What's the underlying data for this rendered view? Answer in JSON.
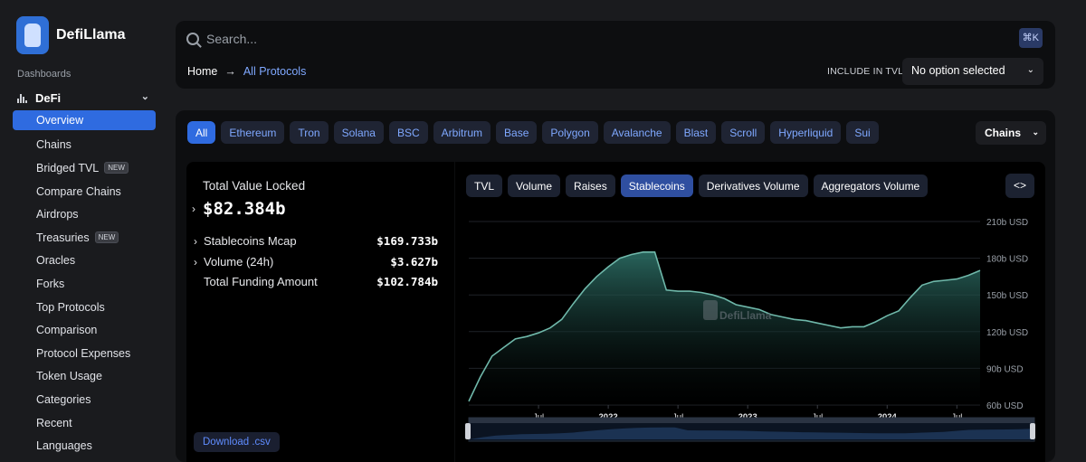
{
  "brand": {
    "name": "DefiLlama"
  },
  "sidebar": {
    "section_label": "Dashboards",
    "group": "DeFi",
    "items": [
      {
        "label": "Overview",
        "active": true
      },
      {
        "label": "Chains"
      },
      {
        "label": "Bridged TVL",
        "badge": "NEW"
      },
      {
        "label": "Compare Chains"
      },
      {
        "label": "Airdrops"
      },
      {
        "label": "Treasuries",
        "badge": "NEW"
      },
      {
        "label": "Oracles"
      },
      {
        "label": "Forks"
      },
      {
        "label": "Top Protocols"
      },
      {
        "label": "Comparison"
      },
      {
        "label": "Protocol Expenses"
      },
      {
        "label": "Token Usage"
      },
      {
        "label": "Categories"
      },
      {
        "label": "Recent"
      },
      {
        "label": "Languages"
      }
    ]
  },
  "search": {
    "placeholder": "Search...",
    "shortcut": "⌘K"
  },
  "breadcrumb": {
    "home": "Home",
    "current": "All Protocols"
  },
  "tvl_filter": {
    "label": "INCLUDE IN TVL:",
    "value": "No option selected"
  },
  "chain_tabs": [
    "All",
    "Ethereum",
    "Tron",
    "Solana",
    "BSC",
    "Arbitrum",
    "Base",
    "Polygon",
    "Avalanche",
    "Blast",
    "Scroll",
    "Hyperliquid",
    "Sui"
  ],
  "chains_dropdown": "Chains",
  "stats": {
    "tvl_label": "Total Value Locked",
    "tvl_value": "$82.384b",
    "rows": [
      {
        "label": "Stablecoins Mcap",
        "value": "$169.733b",
        "expandable": true
      },
      {
        "label": "Volume (24h)",
        "value": "$3.627b",
        "expandable": true
      },
      {
        "label": "Total Funding Amount",
        "value": "$102.784b",
        "expandable": false
      }
    ],
    "download": "Download .csv"
  },
  "metric_tabs": [
    {
      "label": "TVL"
    },
    {
      "label": "Volume"
    },
    {
      "label": "Raises"
    },
    {
      "label": "Stablecoins",
      "active": true
    },
    {
      "label": "Derivatives Volume"
    },
    {
      "label": "Aggregators Volume"
    }
  ],
  "colors": {
    "accent": "#2f6be0",
    "line": "#6fb8aa",
    "area_top": "#2d6f66",
    "link": "#7fa8ff"
  },
  "chart_data": {
    "type": "area",
    "ylabel": "",
    "ylim": [
      60,
      210
    ],
    "y_ticks": [
      "210b USD",
      "180b USD",
      "150b USD",
      "120b USD",
      "90b USD",
      "60b USD"
    ],
    "x_ticks": [
      "Jul",
      "2022",
      "Jul",
      "2023",
      "Jul",
      "2024",
      "Jul"
    ],
    "watermark": "DefiLlama",
    "series": [
      {
        "values": [
          {
            "x": "2021-01",
            "y": 63
          },
          {
            "x": "2021-02",
            "y": 83
          },
          {
            "x": "2021-03",
            "y": 100
          },
          {
            "x": "2021-04",
            "y": 107
          },
          {
            "x": "2021-05",
            "y": 114
          },
          {
            "x": "2021-06",
            "y": 116
          },
          {
            "x": "2021-07",
            "y": 119
          },
          {
            "x": "2021-08",
            "y": 123
          },
          {
            "x": "2021-09",
            "y": 130
          },
          {
            "x": "2021-10",
            "y": 143
          },
          {
            "x": "2021-11",
            "y": 155
          },
          {
            "x": "2021-12",
            "y": 165
          },
          {
            "x": "2022-01",
            "y": 173
          },
          {
            "x": "2022-02",
            "y": 180
          },
          {
            "x": "2022-03",
            "y": 183
          },
          {
            "x": "2022-04",
            "y": 185
          },
          {
            "x": "2022-05",
            "y": 185
          },
          {
            "x": "2022-06",
            "y": 154
          },
          {
            "x": "2022-07",
            "y": 153
          },
          {
            "x": "2022-08",
            "y": 153
          },
          {
            "x": "2022-09",
            "y": 152
          },
          {
            "x": "2022-10",
            "y": 150
          },
          {
            "x": "2022-11",
            "y": 147
          },
          {
            "x": "2022-12",
            "y": 142
          },
          {
            "x": "2023-01",
            "y": 140
          },
          {
            "x": "2023-02",
            "y": 138
          },
          {
            "x": "2023-03",
            "y": 134
          },
          {
            "x": "2023-04",
            "y": 132
          },
          {
            "x": "2023-05",
            "y": 130
          },
          {
            "x": "2023-06",
            "y": 129
          },
          {
            "x": "2023-07",
            "y": 127
          },
          {
            "x": "2023-08",
            "y": 125
          },
          {
            "x": "2023-09",
            "y": 123
          },
          {
            "x": "2023-10",
            "y": 124
          },
          {
            "x": "2023-11",
            "y": 124
          },
          {
            "x": "2023-12",
            "y": 128
          },
          {
            "x": "2024-01",
            "y": 133
          },
          {
            "x": "2024-02",
            "y": 137
          },
          {
            "x": "2024-03",
            "y": 148
          },
          {
            "x": "2024-04",
            "y": 158
          },
          {
            "x": "2024-05",
            "y": 161
          },
          {
            "x": "2024-06",
            "y": 162
          },
          {
            "x": "2024-07",
            "y": 163
          },
          {
            "x": "2024-08",
            "y": 166
          },
          {
            "x": "2024-09",
            "y": 170
          }
        ]
      }
    ]
  }
}
